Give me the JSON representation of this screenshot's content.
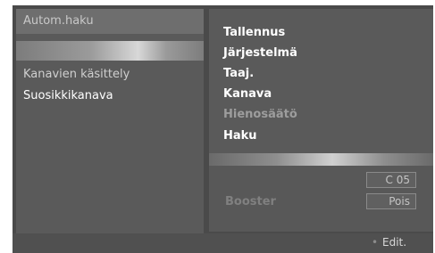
{
  "left_menu": {
    "title": "Autom.haku",
    "items": [
      {
        "label": "Kanavien käsittely"
      },
      {
        "label": "Suosikkikanava"
      }
    ]
  },
  "right_menu": {
    "items": [
      {
        "label": "Tallennus"
      },
      {
        "label": "Järjestelmä"
      },
      {
        "label": "Taaj."
      },
      {
        "label": "Kanava"
      },
      {
        "label": "Hienosäätö"
      },
      {
        "label": "Haku"
      }
    ]
  },
  "lower": {
    "channel_value": "C 05",
    "booster_label": "Booster",
    "booster_value": "Pois"
  },
  "footer": {
    "edit_label": "Edit."
  },
  "colors": {
    "screen_bg": "#4a4a4a",
    "panel_bg": "#5a5a5a",
    "text_active": "#ffffff",
    "text_dim": "#9d9d9d"
  }
}
